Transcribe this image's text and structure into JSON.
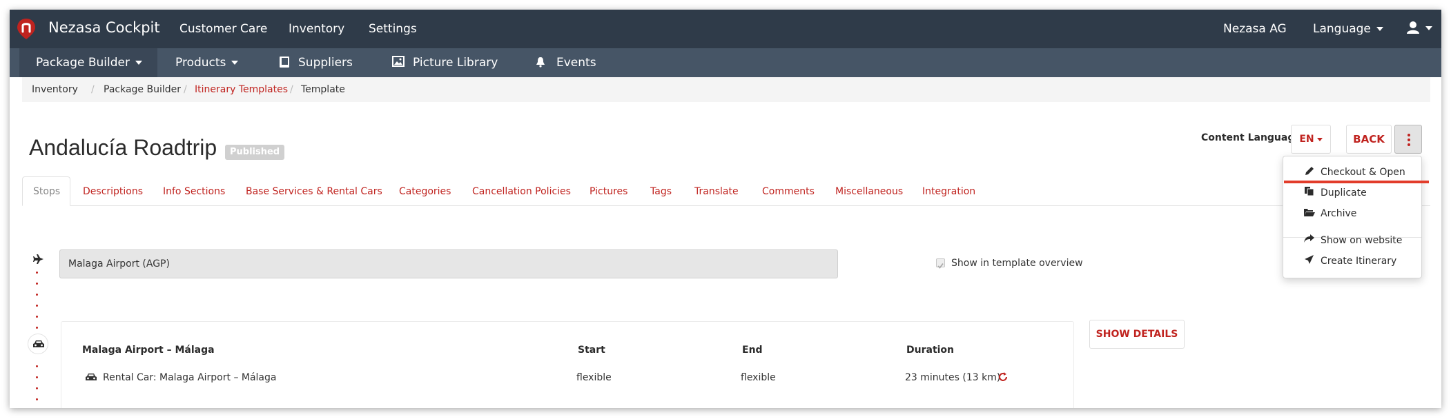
{
  "app": {
    "brand": "Nezasa Cockpit"
  },
  "topnav": {
    "items": [
      "Customer Care",
      "Inventory",
      "Settings"
    ],
    "company": "Nezasa AG",
    "language": "Language"
  },
  "subnav": {
    "items": [
      "Package Builder",
      "Products",
      "Suppliers",
      "Picture Library",
      "Events"
    ]
  },
  "breadcrumb": [
    "Inventory",
    "Package Builder",
    "Itinerary Templates",
    "Template"
  ],
  "page": {
    "title": "Andalucía Roadtrip",
    "status": "Published",
    "content_language_label": "Content Language",
    "language_value": "EN",
    "back_label": "BACK"
  },
  "actions_menu": {
    "items": [
      "Checkout & Open",
      "Duplicate",
      "Archive",
      "Show on website",
      "Create Itinerary"
    ]
  },
  "tabs": [
    "Stops",
    "Descriptions",
    "Info Sections",
    "Base Services & Rental Cars",
    "Categories",
    "Cancellation Policies",
    "Pictures",
    "Tags",
    "Translate",
    "Comments",
    "Miscellaneous",
    "Integration"
  ],
  "stop": {
    "name": "Malaga Airport (AGP)",
    "show_in_overview_label": "Show in template overview",
    "show_in_overview": true
  },
  "route": {
    "title": "Malaga Airport  – Málaga",
    "columns": [
      "Start",
      "End",
      "Duration"
    ],
    "service": "Rental Car: Malaga Airport  – Málaga",
    "start": "flexible",
    "end": "flexible",
    "duration": "23 minutes (13 km)",
    "show_details_label": "SHOW DETAILS"
  },
  "colors": {
    "accent": "#c0231f",
    "nav_dark": "#2f3b49",
    "nav_secondary": "#465566"
  }
}
